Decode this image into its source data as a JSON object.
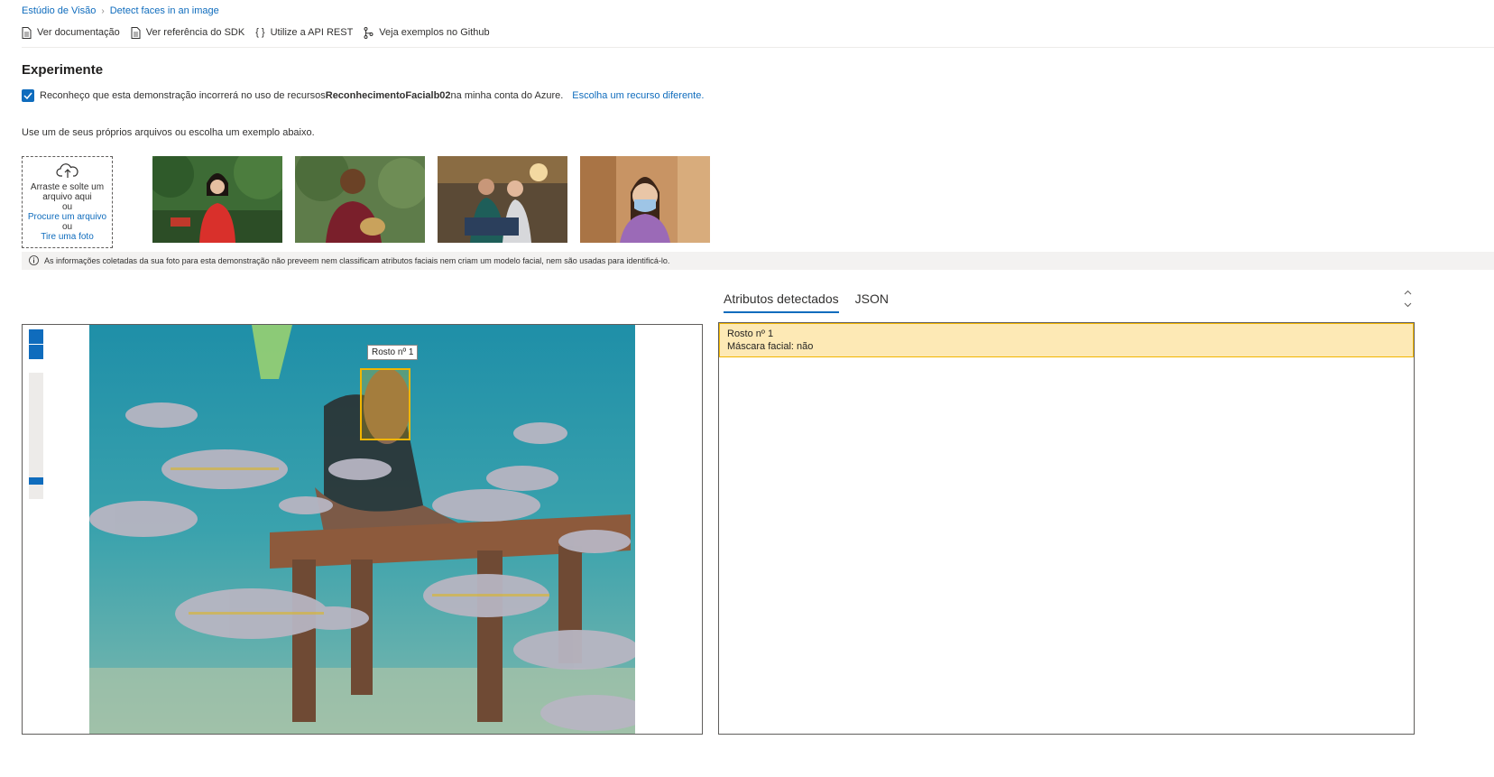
{
  "breadcrumb": {
    "root": "Estúdio de Visão",
    "separator": "›",
    "current": "Detect faces in an image"
  },
  "toolbar": {
    "docs": "Ver documentação",
    "sdk": "Ver referência do SDK",
    "api": "Utilize a API REST",
    "github": "Veja exemplos no Github"
  },
  "section_title": "Experimente",
  "consent": {
    "checked": true,
    "text_before": "Reconheço que esta demonstração incorrerá no uso de recursos",
    "resource_name": "ReconhecimentoFacialb02",
    "text_after": "na minha conta do Azure.",
    "change_link": "Escolha um recurso diferente."
  },
  "intro_text": "Use um de seus próprios arquivos ou escolha um exemplo abaixo.",
  "upload": {
    "drag_text": "Arraste e solte um arquivo aqui",
    "or1": "ou",
    "browse_link": "Procure um arquivo",
    "or2": "ou",
    "photo_link": "Tire uma foto"
  },
  "info_text": "As informações coletadas da sua foto para esta demonstração não preveem nem classificam atributos faciais nem criam um modelo facial, nem são usadas para identificá-lo.",
  "tabs": {
    "detected": "Atributos detectados",
    "json": "JSON"
  },
  "face": {
    "label": "Rosto nº 1",
    "mask": "Máscara facial: não"
  },
  "colors": {
    "accent": "#0f6cbd",
    "highlight": "#fde9b5",
    "highlight_border": "#f2b600"
  }
}
